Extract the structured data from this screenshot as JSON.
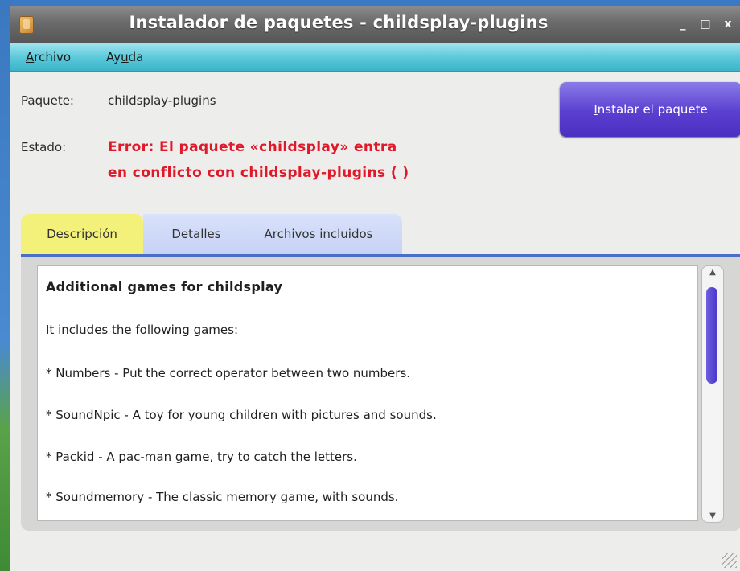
{
  "window": {
    "title": "Instalador de paquetes - childsplay-plugins",
    "controls": [
      "_",
      "□",
      "x"
    ]
  },
  "menu": {
    "archivo": {
      "u": "A",
      "rest": "rchivo"
    },
    "ayuda": {
      "pre": "Ay",
      "u": "u",
      "rest": "da"
    }
  },
  "package": {
    "label": "Paquete:",
    "name": "childsplay-plugins"
  },
  "status": {
    "label": "Estado:",
    "line1": "Error: El paquete «childsplay» entra",
    "line2": "en conflicto con childsplay-plugins ( )"
  },
  "install_button": {
    "u": "I",
    "rest": "nstalar el paquete"
  },
  "tabs": {
    "descripcion": "Descripción",
    "detalles": "Detalles",
    "archivos": "Archivos incluidos"
  },
  "description": {
    "heading": "Additional games for childsplay",
    "intro": "It includes the following games:",
    "items": [
      "* Numbers - Put the correct operator between two numbers.",
      "* SoundNpic - A toy for young children with pictures and sounds.",
      "* Packid - A pac-man game, try to catch the letters.",
      "* Soundmemory - The classic memory game, with sounds."
    ]
  },
  "colors": {
    "titlebar": "#6a6a6a",
    "menubar": "#57c7d9",
    "error_text": "#e0182a",
    "install_button": "#5a3fd0",
    "active_tab": "#f3f179",
    "inactive_tabs": "#c6d2f5"
  }
}
